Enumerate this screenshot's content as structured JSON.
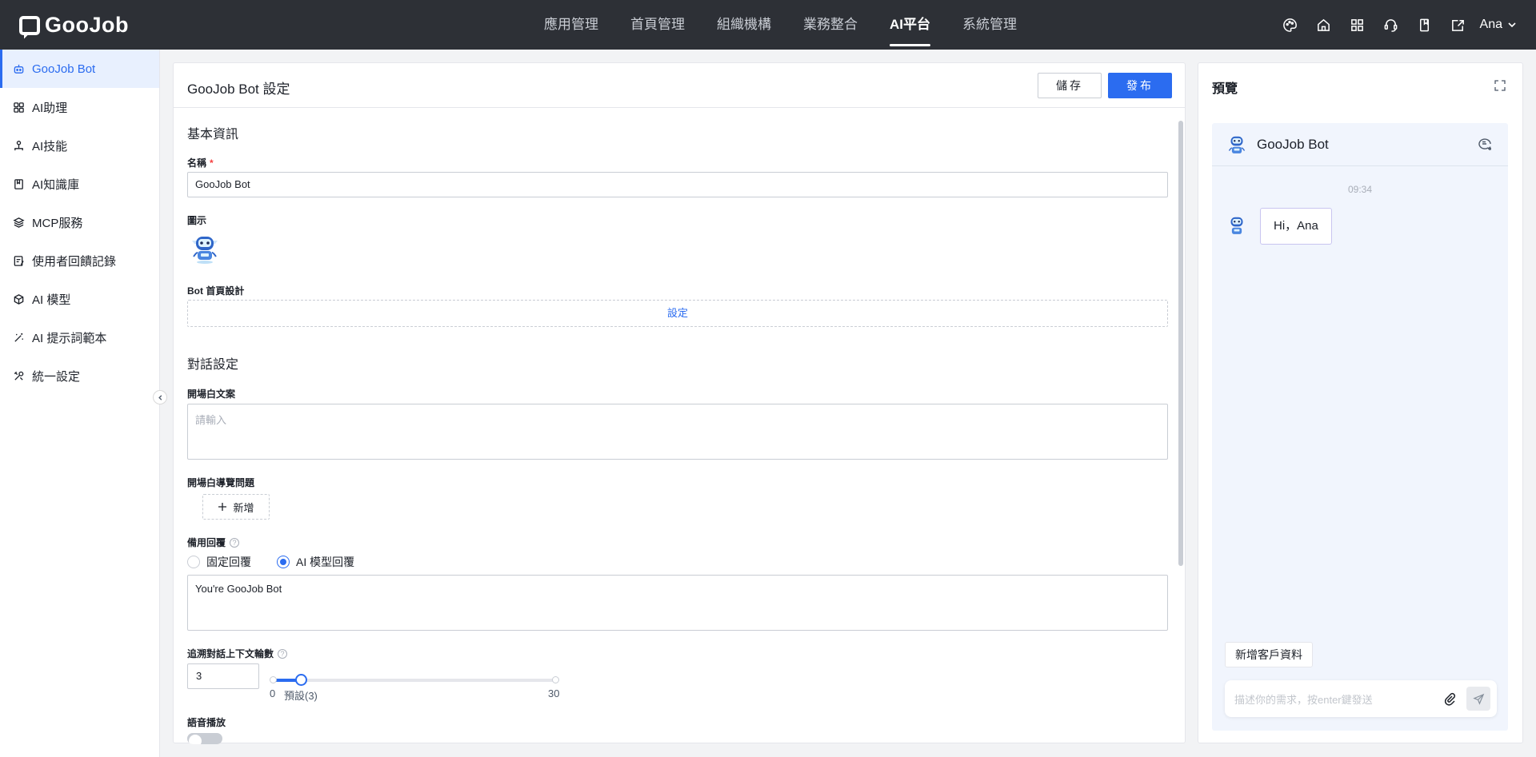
{
  "brand": {
    "name": "GooJob"
  },
  "topnav": [
    "應用管理",
    "首頁管理",
    "組織機構",
    "業務整合",
    "AI平台",
    "系統管理"
  ],
  "topnav_active": "AI平台",
  "user": {
    "name": "Ana"
  },
  "sidebar": {
    "items": [
      {
        "label": "GooJob Bot",
        "icon": "robot-icon"
      },
      {
        "label": "AI助理",
        "icon": "grid-icon"
      },
      {
        "label": "AI技能",
        "icon": "skill-icon"
      },
      {
        "label": "AI知識庫",
        "icon": "book-icon"
      },
      {
        "label": "MCP服務",
        "icon": "layers-icon"
      },
      {
        "label": "使用者回饋記錄",
        "icon": "feedback-icon"
      },
      {
        "label": "AI 模型",
        "icon": "cube-icon"
      },
      {
        "label": "AI 提示詞範本",
        "icon": "magic-wand-icon"
      },
      {
        "label": "統一設定",
        "icon": "tools-icon"
      }
    ]
  },
  "main": {
    "title": "GooJob Bot 設定",
    "save_label": "儲存",
    "publish_label": "發布",
    "basic_section": "基本資訊",
    "name_label": "名稱",
    "name_required": "*",
    "name_value": "GooJob Bot",
    "icon_label": "圖示",
    "homepage_label": "Bot 首頁設計",
    "homepage_action": "設定",
    "dialog_section": "對話設定",
    "opening_label": "開場白文案",
    "opening_placeholder": "請輸入",
    "guide_label": "開場白導覽問題",
    "add_label": "新增",
    "fallback_label": "備用回覆",
    "fallback_options": [
      "固定回覆",
      "AI 模型回覆"
    ],
    "fallback_selected": "AI 模型回覆",
    "fallback_value": "You're GooJob Bot",
    "context_label": "追溯對話上下文輪數",
    "context_value": "3",
    "slider": {
      "min": 0,
      "max": 30,
      "value": 3,
      "min_label": "0",
      "default_label": "預設(3)",
      "max_label": "30"
    },
    "voice_label": "語音播放",
    "voice_on": false
  },
  "preview": {
    "title": "預覽",
    "bot_name": "GooJob Bot",
    "time": "09:34",
    "greeting": "Hi，Ana",
    "quick_action": "新增客戶資料",
    "input_placeholder": "描述你的需求，按enter鍵發送"
  },
  "colors": {
    "accent": "#2b6cf0",
    "topbar": "#2d3036",
    "chat_bg": "#f1f5fd"
  }
}
